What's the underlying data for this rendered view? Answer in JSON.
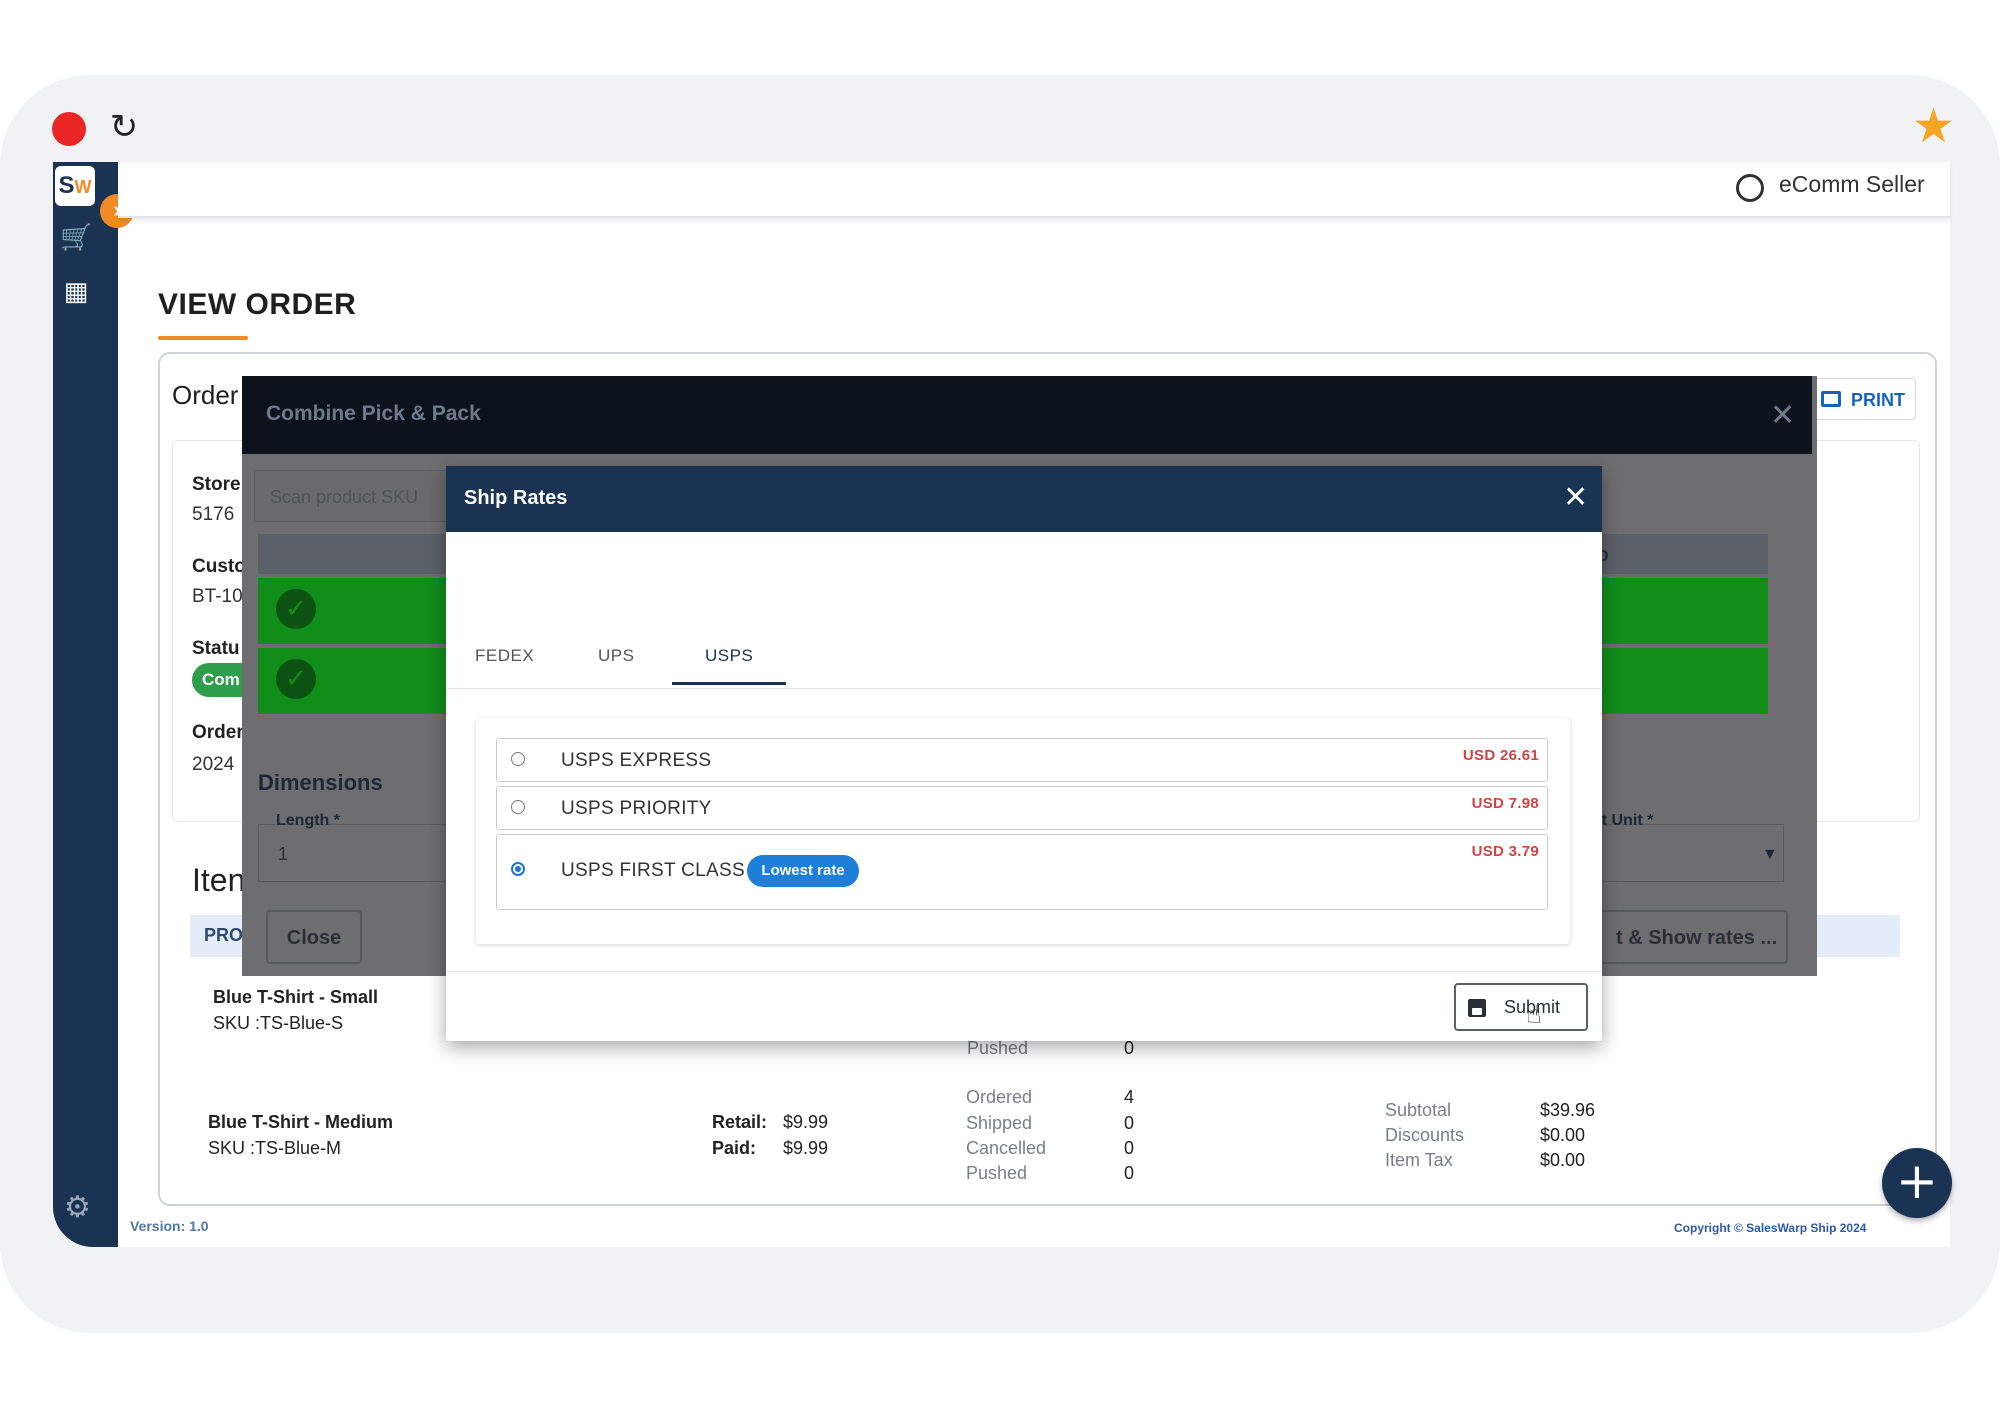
{
  "window": {
    "reload_icon": "↻",
    "star_icon": "★"
  },
  "sidebar": {
    "logo_main": "S",
    "logo_accent": "W",
    "expand_icon": "›",
    "cart_icon": "🛒",
    "store_icon": "▦",
    "settings_icon": "⚙"
  },
  "header": {
    "user_name": "eComm Seller"
  },
  "page": {
    "title": "VIEW ORDER",
    "order_label": "Order",
    "print_label": "PRINT"
  },
  "order_info": {
    "store_label": "Store",
    "store_value": "5176",
    "customer_label": "Custo",
    "customer_value": "BT-10",
    "status_label": "Statu",
    "status_value": "Com",
    "order_label": "Order",
    "order_value": "2024"
  },
  "items": {
    "title": "Iten",
    "header_label": "PRO",
    "rows": [
      {
        "name": "Blue T-Shirt - Small",
        "sku": "SKU :TS-Blue-S",
        "pushed_label": "Pushed",
        "pushed": "0"
      },
      {
        "name": "Blue T-Shirt - Medium",
        "sku": "SKU :TS-Blue-M",
        "retail_label": "Retail:",
        "retail": "$9.99",
        "paid_label": "Paid:",
        "paid": "$9.99",
        "ordered_label": "Ordered",
        "ordered": "4",
        "shipped_label": "Shipped",
        "shipped": "0",
        "cancelled_label": "Cancelled",
        "cancelled": "0",
        "pushed_label": "Pushed",
        "pushed": "0",
        "subtotal_label": "Subtotal",
        "subtotal": "$39.96",
        "discounts_label": "Discounts",
        "discounts": "$0.00",
        "itemtax_label": "Item Tax",
        "itemtax": "$0.00"
      }
    ]
  },
  "pick_pack": {
    "title": "Combine Pick & Pack",
    "scan_placeholder": "Scan product SKU",
    "dimensions_title": "Dimensions",
    "length_label": "Length *",
    "length_value": "1",
    "weight_unit_label": "ht Unit *",
    "close_label": "Close",
    "show_rates_label": "t & Show rates ...",
    "header_fragment": "D"
  },
  "ship_rates": {
    "title": "Ship Rates",
    "tabs": [
      {
        "label": "FEDEX"
      },
      {
        "label": "UPS"
      },
      {
        "label": "USPS"
      }
    ],
    "active_tab": "USPS",
    "rates": [
      {
        "name": "USPS EXPRESS",
        "price": "USD 26.61",
        "selected": false
      },
      {
        "name": "USPS PRIORITY",
        "price": "USD 7.98",
        "selected": false
      },
      {
        "name": "USPS FIRST CLASS",
        "price": "USD 3.79",
        "selected": true,
        "badge": "Lowest rate"
      }
    ],
    "submit_label": "Submit"
  },
  "footer": {
    "version": "Version: 1.0",
    "copyright": "Copyright © SalesWarp Ship 2024"
  },
  "fab_icon": "+"
}
